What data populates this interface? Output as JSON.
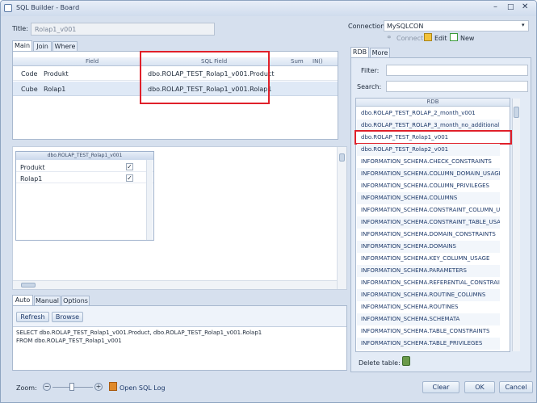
{
  "window": {
    "title": "SQL Builder - Board"
  },
  "title_field": {
    "label": "Title:",
    "value": "Rolap1_v001"
  },
  "connection": {
    "label": "Connection:",
    "value": "MySQLCON",
    "connect": "Connect",
    "edit": "Edit",
    "new": "New"
  },
  "top_tabs": [
    "Main",
    "Join",
    "Where"
  ],
  "grid": {
    "headers": [
      "Field",
      "SQL Field",
      "Sum",
      "IN()"
    ],
    "rows": [
      {
        "col": "Code",
        "field": "Produkt",
        "sql": "dbo.ROLAP_TEST_Rolap1_v001.Product"
      },
      {
        "col": "Cube",
        "field": "Rolap1",
        "sql": "dbo.ROLAP_TEST_Rolap1_v001.Rolap1"
      }
    ]
  },
  "table_box": {
    "title": "dbo.ROLAP_TEST_Rolap1_v001",
    "fields": [
      {
        "name": "Produkt",
        "checked": true
      },
      {
        "name": "Rolap1",
        "checked": true
      }
    ]
  },
  "bottom_tabs": [
    "Auto",
    "Manual",
    "Options"
  ],
  "auto": {
    "refresh": "Refresh",
    "browse": "Browse",
    "sql": [
      "SELECT dbo.ROLAP_TEST_Rolap1_v001.Product, dbo.ROLAP_TEST_Rolap1_v001.Rolap1",
      "FROM dbo.ROLAP_TEST_Rolap1_v001"
    ]
  },
  "right_tabs": [
    "RDB",
    "More"
  ],
  "filter_label": "Filter:",
  "search_label": "Search:",
  "rdb": {
    "header": "RDB",
    "items": [
      {
        "name": "dbo.ROLAP_TEST_ROLAP_2_month_v001",
        "checked": false
      },
      {
        "name": "dbo.ROLAP_TEST_ROLAP_3_month_no_additional",
        "checked": false
      },
      {
        "name": "dbo.ROLAP_TEST_Rolap1_v001",
        "checked": true
      },
      {
        "name": "dbo.ROLAP_TEST_Rolap2_v001",
        "checked": false
      },
      {
        "name": "INFORMATION_SCHEMA.CHECK_CONSTRAINTS",
        "checked": false
      },
      {
        "name": "INFORMATION_SCHEMA.COLUMN_DOMAIN_USAGE",
        "checked": false
      },
      {
        "name": "INFORMATION_SCHEMA.COLUMN_PRIVILEGES",
        "checked": false
      },
      {
        "name": "INFORMATION_SCHEMA.COLUMNS",
        "checked": false
      },
      {
        "name": "INFORMATION_SCHEMA.CONSTRAINT_COLUMN_USAGE",
        "checked": false
      },
      {
        "name": "INFORMATION_SCHEMA.CONSTRAINT_TABLE_USAGE",
        "checked": false
      },
      {
        "name": "INFORMATION_SCHEMA.DOMAIN_CONSTRAINTS",
        "checked": false
      },
      {
        "name": "INFORMATION_SCHEMA.DOMAINS",
        "checked": false
      },
      {
        "name": "INFORMATION_SCHEMA.KEY_COLUMN_USAGE",
        "checked": false
      },
      {
        "name": "INFORMATION_SCHEMA.PARAMETERS",
        "checked": false
      },
      {
        "name": "INFORMATION_SCHEMA.REFERENTIAL_CONSTRAINTS",
        "checked": false
      },
      {
        "name": "INFORMATION_SCHEMA.ROUTINE_COLUMNS",
        "checked": false
      },
      {
        "name": "INFORMATION_SCHEMA.ROUTINES",
        "checked": false
      },
      {
        "name": "INFORMATION_SCHEMA.SCHEMATA",
        "checked": false
      },
      {
        "name": "INFORMATION_SCHEMA.TABLE_CONSTRAINTS",
        "checked": false
      },
      {
        "name": "INFORMATION_SCHEMA.TABLE_PRIVILEGES",
        "checked": false
      }
    ]
  },
  "delete_table": "Delete table:",
  "footer": {
    "zoom": "Zoom:",
    "open_log": "Open SQL Log",
    "clear": "Clear",
    "ok": "OK",
    "cancel": "Cancel"
  },
  "colors": {
    "highlight": "#e0202a",
    "accent": "#1e3a6a"
  }
}
